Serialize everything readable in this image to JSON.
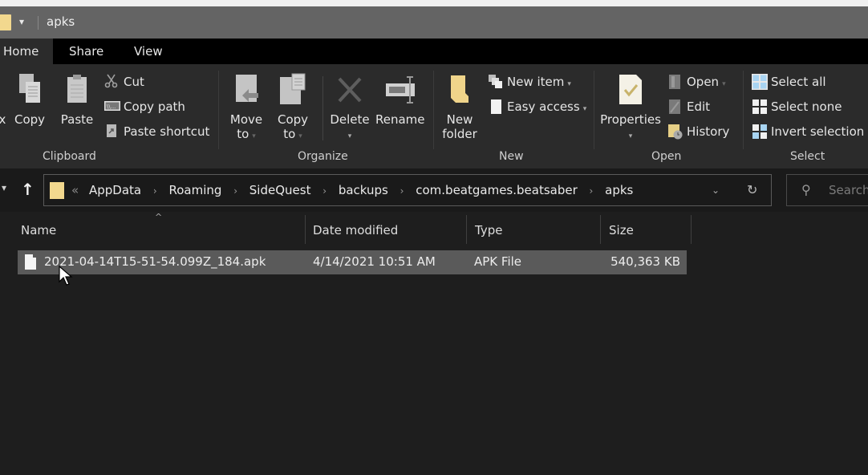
{
  "window": {
    "title": "apks",
    "quick_access_dropdown": "▾"
  },
  "tabs": [
    {
      "label": "Home",
      "active": true
    },
    {
      "label": "Share",
      "active": false
    },
    {
      "label": "View",
      "active": false
    }
  ],
  "ribbon": {
    "clipboard": {
      "label": "Clipboard",
      "cut_partial": "x",
      "copy": "Copy",
      "paste": "Paste",
      "cut": "Cut",
      "copy_path": "Copy path",
      "paste_shortcut": "Paste shortcut"
    },
    "organize": {
      "label": "Organize",
      "move_to": [
        "Move",
        "to"
      ],
      "copy_to": [
        "Copy",
        "to"
      ],
      "delete": "Delete",
      "rename": "Rename"
    },
    "new": {
      "label": "New",
      "new_folder": [
        "New",
        "folder"
      ],
      "new_item": "New item",
      "easy_access": "Easy access"
    },
    "open": {
      "label": "Open",
      "properties": "Properties",
      "open": "Open",
      "edit": "Edit",
      "history": "History"
    },
    "select": {
      "label": "Select",
      "select_all": "Select all",
      "select_none": "Select none",
      "invert_selection": "Invert selection"
    }
  },
  "address_bar": {
    "overflow": "«",
    "crumbs": [
      "AppData",
      "Roaming",
      "SideQuest",
      "backups",
      "com.beatgames.beatsaber",
      "apks"
    ],
    "separator": "›"
  },
  "search": {
    "placeholder": "Search"
  },
  "file_list": {
    "columns": [
      "Name",
      "Date modified",
      "Type",
      "Size"
    ],
    "sorted_by": "Name",
    "rows": [
      {
        "name": "2021-04-14T15-51-54.099Z_184.apk",
        "date_modified": "4/14/2021 10:51 AM",
        "type": "APK File",
        "size": "540,363 KB",
        "selected": true
      }
    ]
  },
  "colors": {
    "titlebar": "#646464",
    "ribbon": "#2b2b2b",
    "content": "#1e1e1e",
    "selection": "#5a5a5a",
    "folder": "#f2d88e"
  }
}
